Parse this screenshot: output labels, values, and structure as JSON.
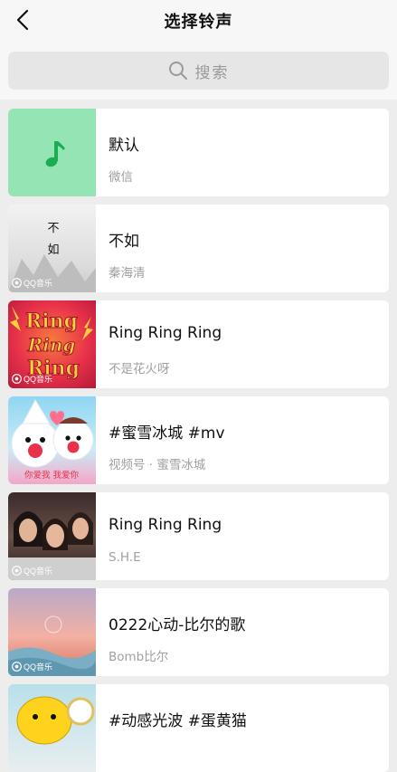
{
  "header": {
    "title": "选择铃声"
  },
  "search": {
    "placeholder": "搜索"
  },
  "colors": {
    "default_thumb": "#95e5b4",
    "note": "#1aad53"
  },
  "items": [
    {
      "title": "默认",
      "subtitle": "微信",
      "icon": "music-note-icon"
    },
    {
      "title": "不如",
      "subtitle": "秦海清",
      "badge": "QQ音乐",
      "cover_text_1": "不",
      "cover_text_2": "如"
    },
    {
      "title": "Ring Ring Ring",
      "subtitle": "不是花火呀",
      "badge": "QQ音乐",
      "cover_text_1": "Ring",
      "cover_text_2": "Ring",
      "cover_text_3": "Ring"
    },
    {
      "title": "#蜜雪冰城 #mv",
      "subtitle": "视频号 · 蜜雪冰城",
      "cover_text_1": "你爱我 我爱你"
    },
    {
      "title": "Ring Ring Ring",
      "subtitle": "S.H.E",
      "badge": "QQ音乐"
    },
    {
      "title": "0222心动-比尔的歌",
      "subtitle": "Bomb比尔",
      "badge": "QQ音乐"
    },
    {
      "title": "#动感光波 #蛋黄猫",
      "subtitle": ""
    }
  ]
}
